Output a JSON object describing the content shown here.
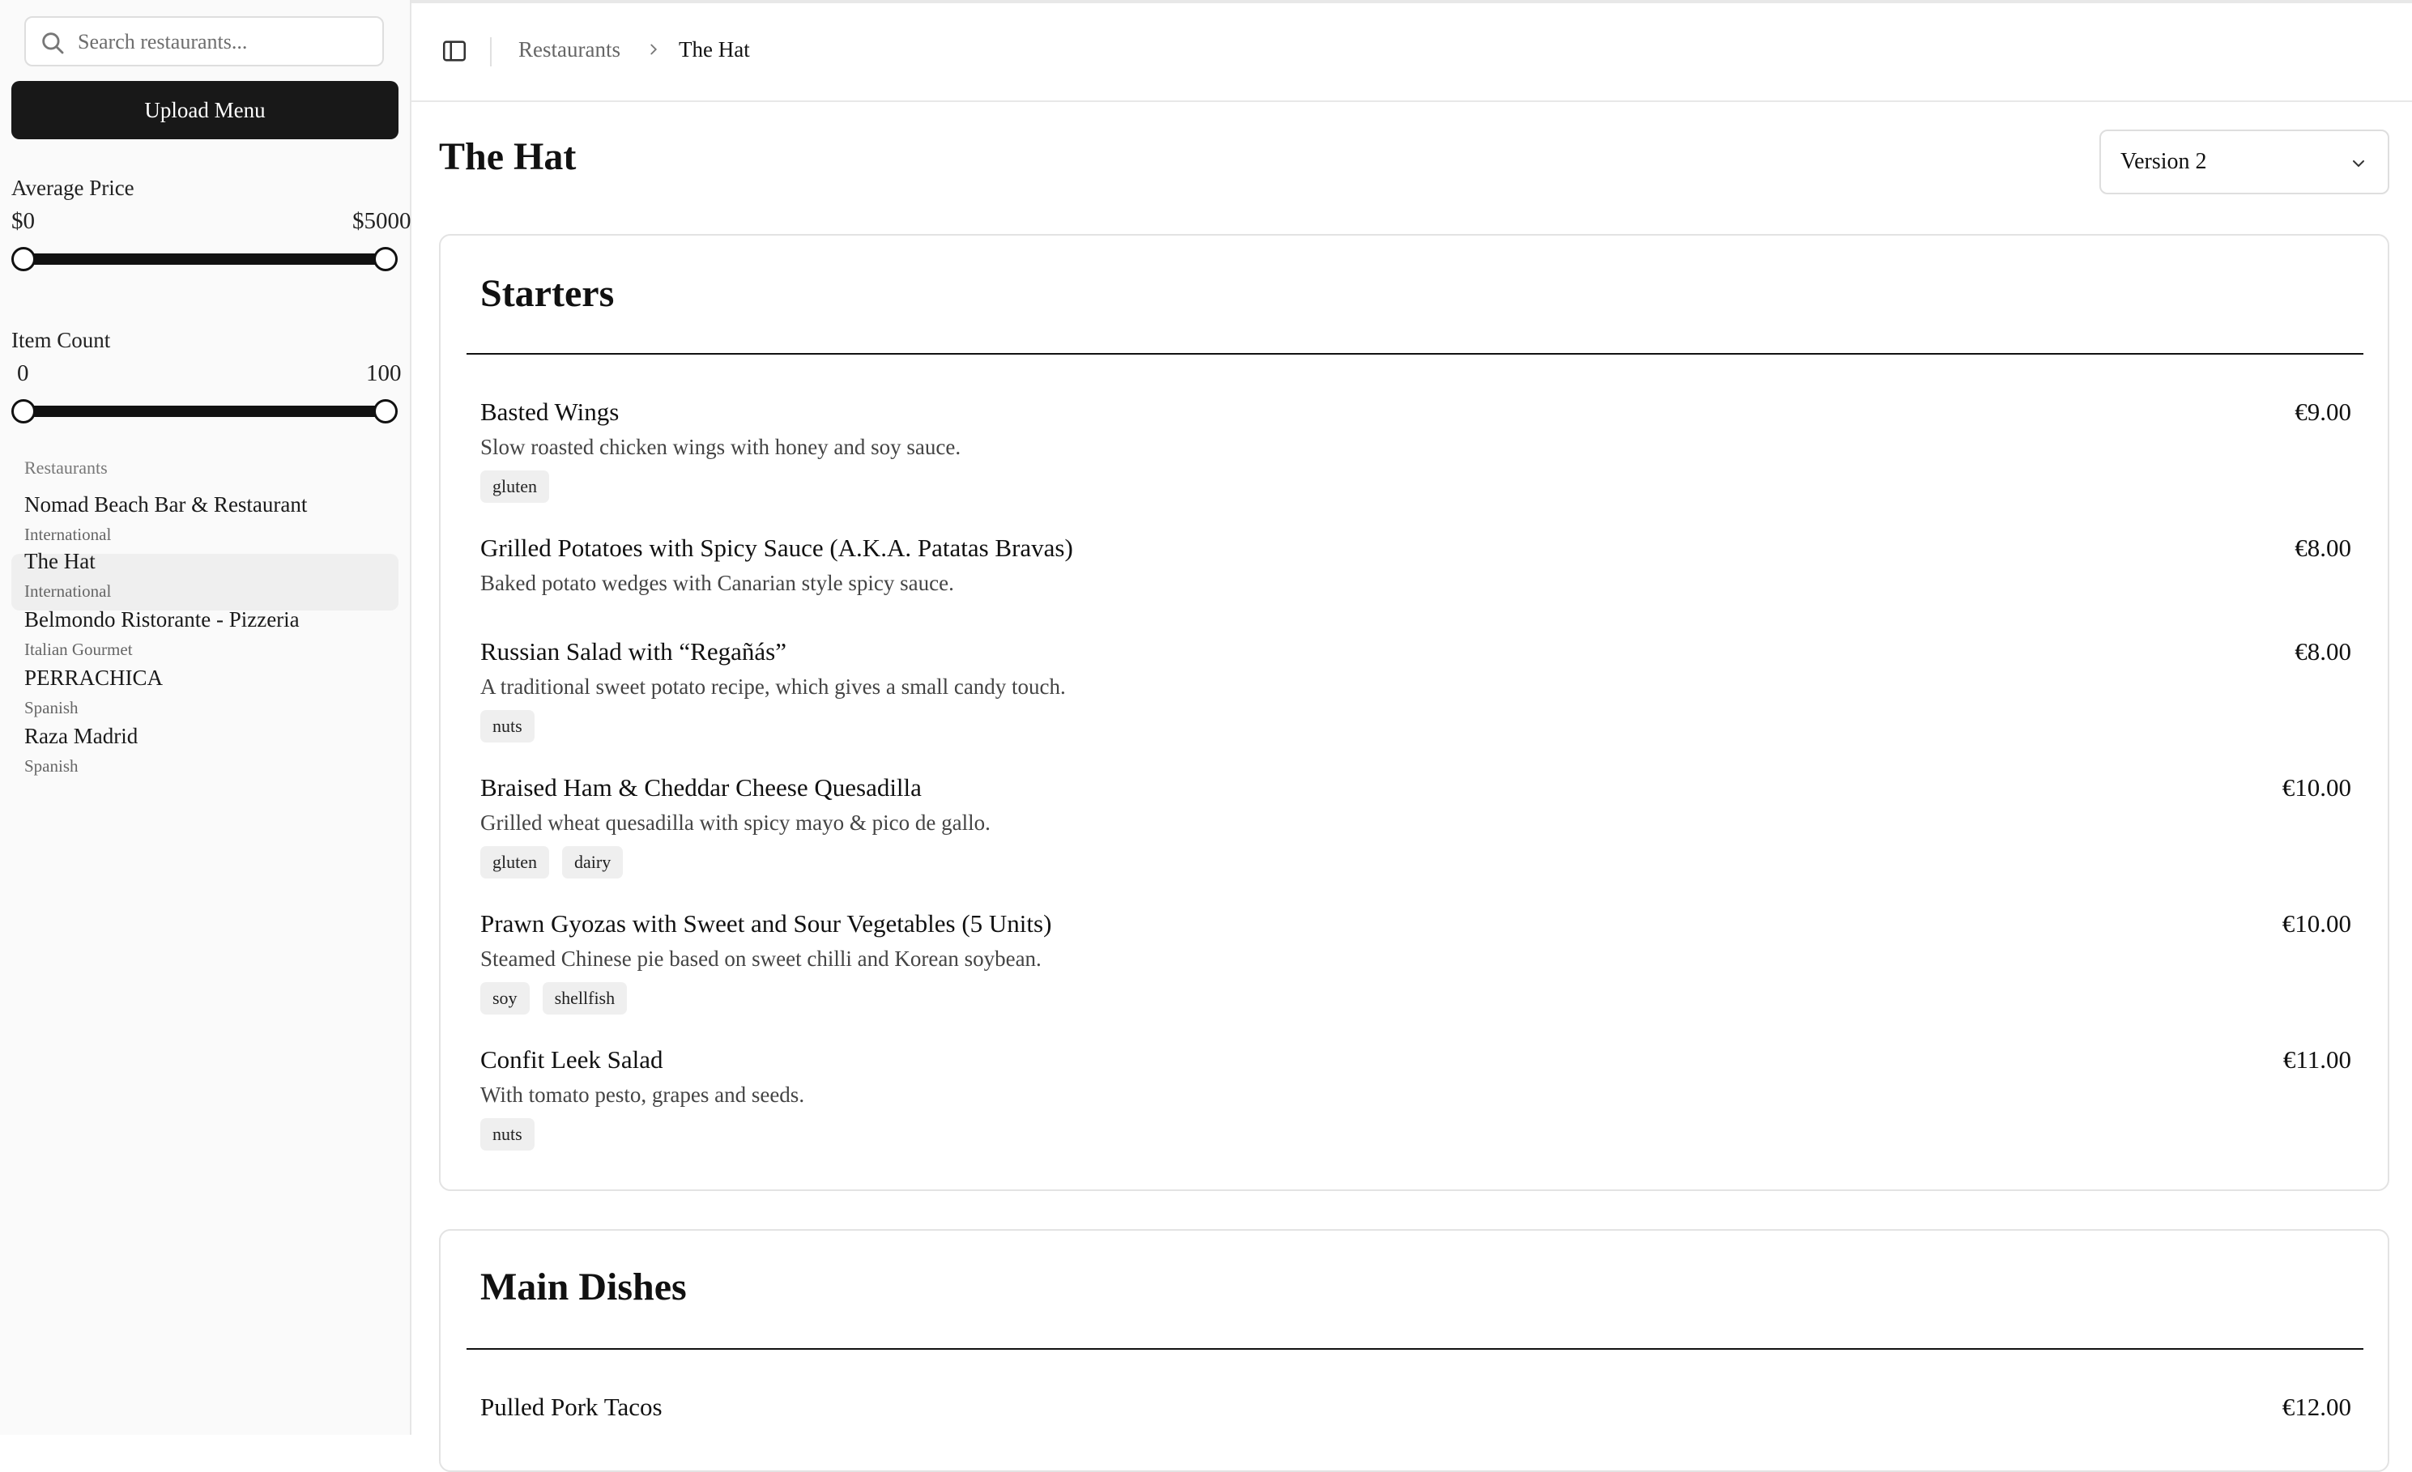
{
  "sidebar": {
    "search_placeholder": "Search restaurants...",
    "upload_label": "Upload Menu",
    "avg_price": {
      "label": "Average Price",
      "min_label": "$0",
      "max_label": "$5000",
      "selected_min_fraction": 0.0,
      "selected_max_fraction": 1.0
    },
    "item_count": {
      "label": "Item Count",
      "min_label": "0",
      "max_label": "100",
      "selected_min_fraction": 0.0,
      "selected_max_fraction": 1.0
    },
    "restaurants_header": "Restaurants",
    "restaurants": [
      {
        "name": "Nomad Beach Bar & Restaurant",
        "cuisine": "International"
      },
      {
        "name": "The Hat",
        "cuisine": "International",
        "selected": true
      },
      {
        "name": "Belmondo Ristorante - Pizzeria",
        "cuisine": "Italian Gourmet"
      },
      {
        "name": "PERRACHICA",
        "cuisine": "Spanish"
      },
      {
        "name": "Raza Madrid",
        "cuisine": "Spanish"
      }
    ]
  },
  "breadcrumb": {
    "parent": "Restaurants",
    "current": "The Hat"
  },
  "page": {
    "title": "The Hat",
    "version": "Version 2"
  },
  "menu": {
    "sections": [
      {
        "title": "Starters",
        "items": [
          {
            "name": "Basted Wings",
            "price": "€9.00",
            "description": "Slow roasted chicken wings with honey and soy sauce.",
            "tags": [
              "gluten"
            ]
          },
          {
            "name": "Grilled Potatoes with Spicy Sauce (A.K.A. Patatas Bravas)",
            "price": "€8.00",
            "description": "Baked potato wedges with Canarian style spicy sauce.",
            "tags": []
          },
          {
            "name": "Russian Salad with “Regañás”",
            "price": "€8.00",
            "description": "A traditional sweet potato recipe, which gives a small candy touch.",
            "tags": [
              "nuts"
            ]
          },
          {
            "name": "Braised Ham & Cheddar Cheese Quesadilla",
            "price": "€10.00",
            "description": "Grilled wheat quesadilla with spicy mayo & pico de gallo.",
            "tags": [
              "gluten",
              "dairy"
            ]
          },
          {
            "name": "Prawn Gyozas with Sweet and Sour Vegetables (5 Units)",
            "price": "€10.00",
            "description": "Steamed Chinese pie based on sweet chilli and Korean soybean.",
            "tags": [
              "soy",
              "shellfish"
            ]
          },
          {
            "name": "Confit Leek Salad",
            "price": "€11.00",
            "description": "With tomato pesto, grapes and seeds.",
            "tags": [
              "nuts"
            ]
          }
        ]
      },
      {
        "title": "Main Dishes",
        "items": [
          {
            "name": "Pulled Pork Tacos",
            "price": "€12.00"
          }
        ]
      }
    ]
  },
  "icons": {
    "search": "search-icon",
    "sidebar_toggle": "sidebar-toggle-icon",
    "breadcrumb_separator": "chevron-right-icon",
    "select": "chevron-down-icon"
  },
  "colors": {
    "primary_button": "#181818",
    "tag_bg": "#efefef",
    "selected_row": "#efefef"
  }
}
